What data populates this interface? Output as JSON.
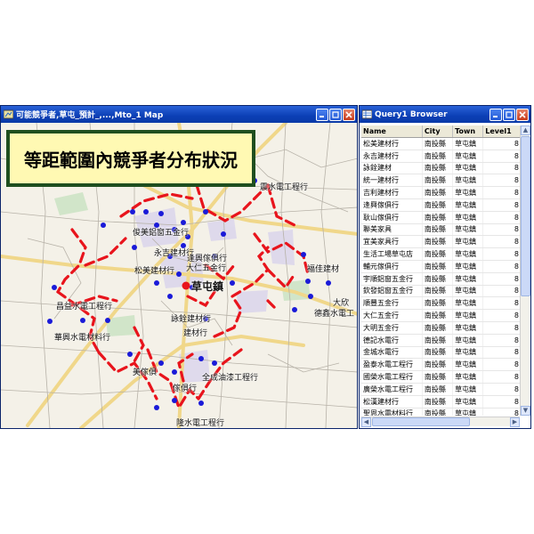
{
  "map_window": {
    "title": "可能競爭者,草屯_預計_,...,Mto_1 Map",
    "banner": "等距範圍內競爭者分布狀況",
    "labels": [
      {
        "text": "震水電工程行"
      },
      {
        "text": "俊美鋁窗五金行"
      },
      {
        "text": "永吉建材行"
      },
      {
        "text": "逢興傢俱行"
      },
      {
        "text": "大仁五金行"
      },
      {
        "text": "松美建材行"
      },
      {
        "text": "福佳建材"
      },
      {
        "text": "草屯鎮",
        "big": true
      },
      {
        "text": "昌益水電工程行"
      },
      {
        "text": "大欣"
      },
      {
        "text": "德鑫水電工"
      },
      {
        "text": "華興水電材料行"
      },
      {
        "text": "詠銓建材行"
      },
      {
        "text": "建材行"
      },
      {
        "text": "美傢俱"
      },
      {
        "text": "全成油漆工程行"
      },
      {
        "text": "傢俱行"
      },
      {
        "text": "隆水電工程行"
      }
    ]
  },
  "query_window": {
    "title": "Query1 Browser",
    "columns": [
      "Name",
      "City",
      "Town",
      "Level1"
    ],
    "rows": [
      [
        "松美建材行",
        "南投縣",
        "草屯鎮",
        "8"
      ],
      [
        "永吉建材行",
        "南投縣",
        "草屯鎮",
        "8"
      ],
      [
        "詠銓建材",
        "南投縣",
        "草屯鎮",
        "8"
      ],
      [
        "統一建材行",
        "南投縣",
        "草屯鎮",
        "8"
      ],
      [
        "吉利建材行",
        "南投縣",
        "草屯鎮",
        "8"
      ],
      [
        "逢興傢俱行",
        "南投縣",
        "草屯鎮",
        "8"
      ],
      [
        "耿山傢俱行",
        "南投縣",
        "草屯鎮",
        "8"
      ],
      [
        "聯美家具",
        "南投縣",
        "草屯鎮",
        "8"
      ],
      [
        "宜美家具行",
        "南投縣",
        "草屯鎮",
        "8"
      ],
      [
        "生活工場草屯店",
        "南投縣",
        "草屯鎮",
        "8"
      ],
      [
        "輔元傢俱行",
        "南投縣",
        "草屯鎮",
        "8"
      ],
      [
        "宇順鋁窗五金行",
        "南投縣",
        "草屯鎮",
        "8"
      ],
      [
        "欽發鋁窗五金行",
        "南投縣",
        "草屯鎮",
        "8"
      ],
      [
        "順豐五金行",
        "南投縣",
        "草屯鎮",
        "8"
      ],
      [
        "大仁五金行",
        "南投縣",
        "草屯鎮",
        "8"
      ],
      [
        "大明五金行",
        "南投縣",
        "草屯鎮",
        "8"
      ],
      [
        "德記水電行",
        "南投縣",
        "草屯鎮",
        "8"
      ],
      [
        "金城水電行",
        "南投縣",
        "草屯鎮",
        "8"
      ],
      [
        "盈泰水電工程行",
        "南投縣",
        "草屯鎮",
        "8"
      ],
      [
        "國榮水電工程行",
        "南投縣",
        "草屯鎮",
        "8"
      ],
      [
        "廣榮水電工程行",
        "南投縣",
        "草屯鎮",
        "8"
      ],
      [
        "松漢建材行",
        "南投縣",
        "草屯鎮",
        "8"
      ],
      [
        "聖恩水電材料行",
        "南投縣",
        "草屯鎮",
        "8"
      ]
    ]
  },
  "colors": {
    "titlebar": "#0b3fb5",
    "buffer_line": "#e8141c",
    "competitor_point": "#1a1ad8",
    "center_point": "#e8141c",
    "banner_bg": "#fff9b3",
    "banner_border": "#1f4f1f"
  },
  "icons": [
    "minimize-icon",
    "maximize-icon",
    "close-icon",
    "map-window-icon",
    "query-window-icon"
  ]
}
